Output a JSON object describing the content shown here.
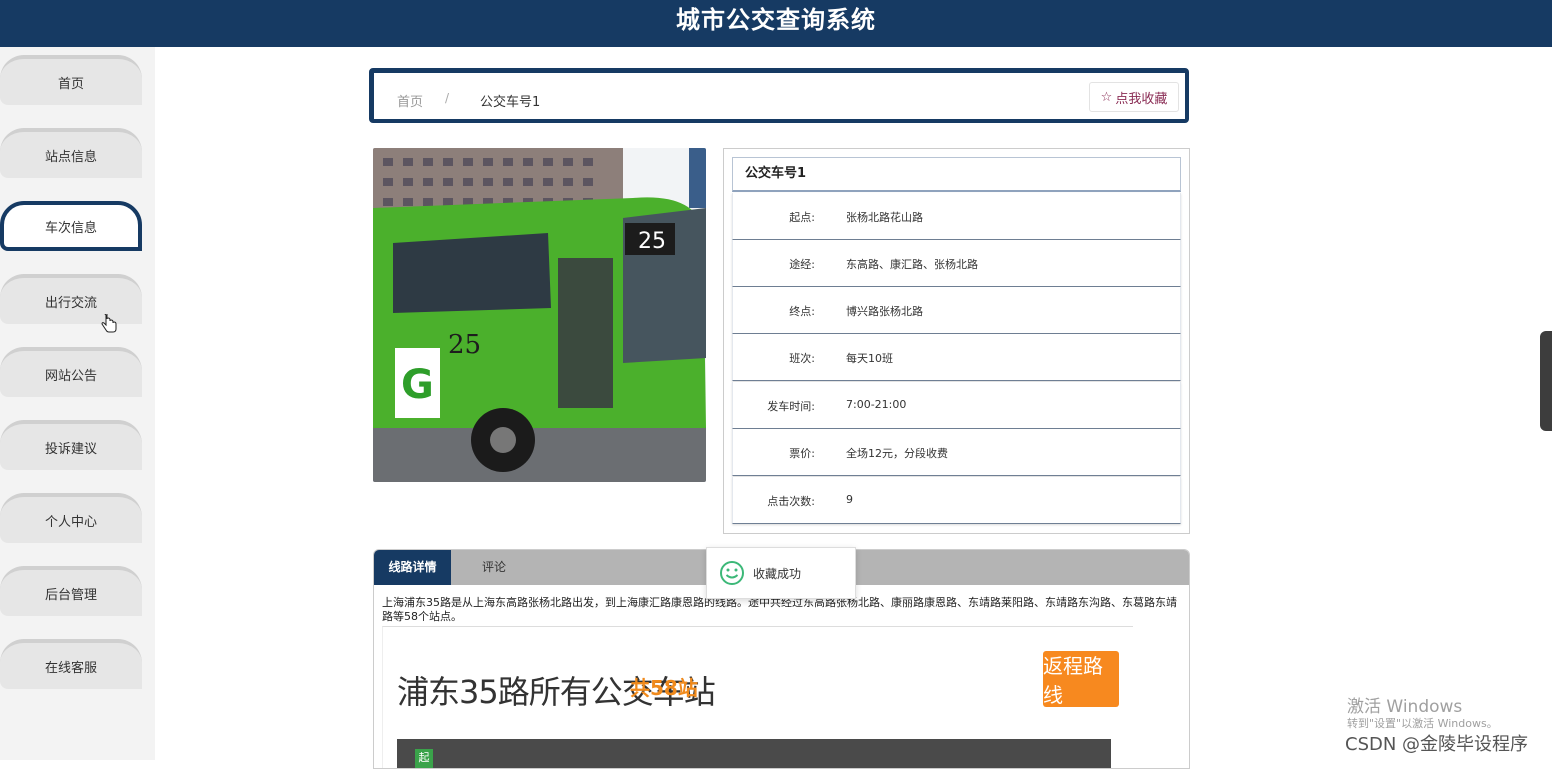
{
  "header": {
    "title": "城市公交查询系统"
  },
  "sidebar": {
    "items": [
      {
        "label": "首页"
      },
      {
        "label": "站点信息"
      },
      {
        "label": "车次信息"
      },
      {
        "label": "出行交流"
      },
      {
        "label": "网站公告"
      },
      {
        "label": "投诉建议"
      },
      {
        "label": "个人中心"
      },
      {
        "label": "后台管理"
      },
      {
        "label": "在线客服"
      }
    ],
    "active": "车次信息"
  },
  "breadcrumb": {
    "home": "首页",
    "separator": "/",
    "current": "公交车号1"
  },
  "favorite_button": {
    "icon": "☆",
    "label": "点我收藏"
  },
  "bus_photo": {
    "route_number": "25",
    "logo_letter": "G",
    "side_number": "25"
  },
  "info": {
    "title": "公交车号1",
    "rows": [
      {
        "label": "起点:",
        "value": "张杨北路花山路"
      },
      {
        "label": "途经:",
        "value": "东高路、康汇路、张杨北路"
      },
      {
        "label": "终点:",
        "value": "博兴路张杨北路"
      },
      {
        "label": "班次:",
        "value": "每天10班"
      },
      {
        "label": "发车时间:",
        "value": "7:00-21:00"
      },
      {
        "label": "票价:",
        "value": "全场12元，分段收费"
      },
      {
        "label": "点击次数:",
        "value": "9"
      }
    ]
  },
  "tabs": [
    {
      "label": "线路详情"
    },
    {
      "label": "评论"
    }
  ],
  "description": "上海浦东35路是从上海东高路张杨北路出发，到上海康汇路康恩路的线路。途中共经过东高路张杨北路、康丽路康恩路、东靖路莱阳路、东靖路东沟路、东葛路东靖路等58个站点。",
  "route_image": {
    "title": "浦东35路所有公交车站",
    "count": "共58站",
    "return_button": "返程路线",
    "start_marker": "起"
  },
  "toast": {
    "message": "收藏成功"
  },
  "watermark": {
    "line1": "激活 Windows",
    "line2": "转到\"设置\"以激活 Windows。"
  },
  "csdn": "CSDN @金陵毕设程序",
  "colors": {
    "primary": "#163a63",
    "accent": "#f7891f",
    "favorite": "#8a2c54"
  }
}
